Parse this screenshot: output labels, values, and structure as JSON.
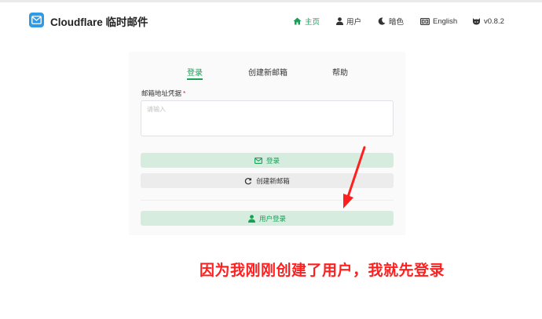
{
  "app": {
    "brand": "Cloudflare 临时邮件"
  },
  "nav": {
    "home": "主页",
    "user": "用户",
    "theme": "暗色",
    "language": "English",
    "version": "v0.8.2"
  },
  "tabs": {
    "login": "登录",
    "create": "创建新邮箱",
    "help": "帮助"
  },
  "form": {
    "credential_label": "邮箱地址凭据",
    "required_mark": "*",
    "credential_placeholder": "请输入",
    "credential_value": ""
  },
  "buttons": {
    "login": "登录",
    "create_new": "创建新邮箱",
    "user_login": "用户登录"
  },
  "annotation": {
    "text": "因为我刚刚创建了用户，我就先登录"
  },
  "colors": {
    "accent": "#18a058",
    "logo": "#2f9be6",
    "annotation": "#ff1f1f"
  },
  "icons": {
    "logo": "mail-icon",
    "home": "home-icon",
    "user": "user-icon",
    "theme": "moon-icon",
    "language": "translate-icon",
    "version": "github-icon",
    "login": "mail-icon",
    "create": "refresh-icon",
    "user_login": "user-icon"
  }
}
